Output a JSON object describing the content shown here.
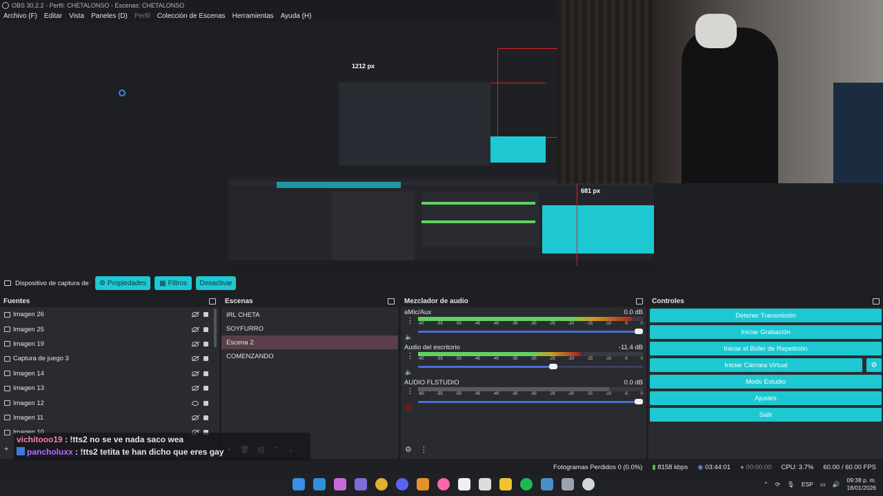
{
  "window": {
    "title": "OBS 30.2.2 - Perfil: CHETALONSO - Escenas: CHETALONSO"
  },
  "menu": [
    {
      "label": "Archivo (F)",
      "enabled": true
    },
    {
      "label": "Editar",
      "enabled": true
    },
    {
      "label": "Vista",
      "enabled": true
    },
    {
      "label": "Paneles (D)",
      "enabled": true
    },
    {
      "label": "Perfil",
      "enabled": false
    },
    {
      "label": "Colección de Escenas",
      "enabled": true
    },
    {
      "label": "Herramientas",
      "enabled": true
    },
    {
      "label": "Ayuda (H)",
      "enabled": true
    }
  ],
  "preview": {
    "label_width": "1212 px",
    "label_height": "681 px"
  },
  "toolbar": {
    "device": "Dispositivo de captura de v",
    "properties": "Propiedades",
    "filters": "Filtros",
    "deactivate": "Desactivar"
  },
  "sources": {
    "title": "Fuentes",
    "items": [
      {
        "name": "Imagen 26",
        "icon": "image-icon",
        "visible": false
      },
      {
        "name": "Imagen 25",
        "icon": "image-icon",
        "visible": false
      },
      {
        "name": "Imagen 19",
        "icon": "image-icon",
        "visible": false
      },
      {
        "name": "Captura de juego 3",
        "icon": "gamepad-icon",
        "visible": false
      },
      {
        "name": "Imagen 14",
        "icon": "image-icon",
        "visible": false
      },
      {
        "name": "Imagen 13",
        "icon": "image-icon",
        "visible": false
      },
      {
        "name": "Imagen 12",
        "icon": "image-icon",
        "visible": true
      },
      {
        "name": "Imagen 11",
        "icon": "image-icon",
        "visible": false
      },
      {
        "name": "Imagen 10",
        "icon": "image-icon",
        "visible": false
      }
    ]
  },
  "scenes": {
    "title": "Escenas",
    "items": [
      {
        "name": "IRL CHETA",
        "selected": false
      },
      {
        "name": "SOYFURRO",
        "selected": false
      },
      {
        "name": "Escena 2",
        "selected": true
      },
      {
        "name": "COMENZANDO",
        "selected": false
      }
    ]
  },
  "mixer": {
    "title": "Mezclador de audio",
    "scale": [
      "-60",
      "-55",
      "-50",
      "-45",
      "-40",
      "-35",
      "-30",
      "-25",
      "-20",
      "-15",
      "-10",
      "-5",
      "0"
    ],
    "tracks": [
      {
        "name": "aMic/Aux",
        "db": "0.0 dB",
        "level": 0.95,
        "volume": 1.0,
        "active": true
      },
      {
        "name": "Audio del escritorio",
        "db": "-11.4 dB",
        "level": 0.72,
        "volume": 0.62,
        "active": true
      },
      {
        "name": "AUDIO FLSTUDIO",
        "db": "0.0 dB",
        "level": 0.85,
        "volume": 1.0,
        "active": false
      }
    ]
  },
  "controls": {
    "title": "Controles",
    "buttons": [
      {
        "label": "Detener Transmisión"
      },
      {
        "label": "Iniciar Grabación"
      },
      {
        "label": "Iniciar el Búfer de Repetición"
      },
      {
        "label": "Iniciar Cámara Virtual"
      },
      {
        "label": "Modo Estudio"
      },
      {
        "label": "Ajustes"
      },
      {
        "label": "Salir"
      }
    ]
  },
  "chat": [
    {
      "user": "vichitooo19",
      "message": " : !tts2 no se ve nada saco wea"
    },
    {
      "user": "pancholuxx",
      "message": " : !tts2 tetita te han dicho que eres gay"
    }
  ],
  "status": {
    "dropped": "Fotogramas Perdidos 0 (0.0%)",
    "bitrate": "8158 kbps",
    "stream_time": "03:44:01",
    "record_time": "00:00:00",
    "cpu": "CPU: 3.7%",
    "fps": "60.00 / 60.00 FPS"
  },
  "taskbar": {
    "lang": "ESP",
    "time": "09:38 p. m.",
    "date": "18/01/2026"
  },
  "colors": {
    "accent": "#1ec8d2",
    "selected_scene": "#5a3f4a",
    "meter_green": "#5fd35f",
    "meter_yellow": "#c8a020",
    "meter_red": "#b02020"
  }
}
